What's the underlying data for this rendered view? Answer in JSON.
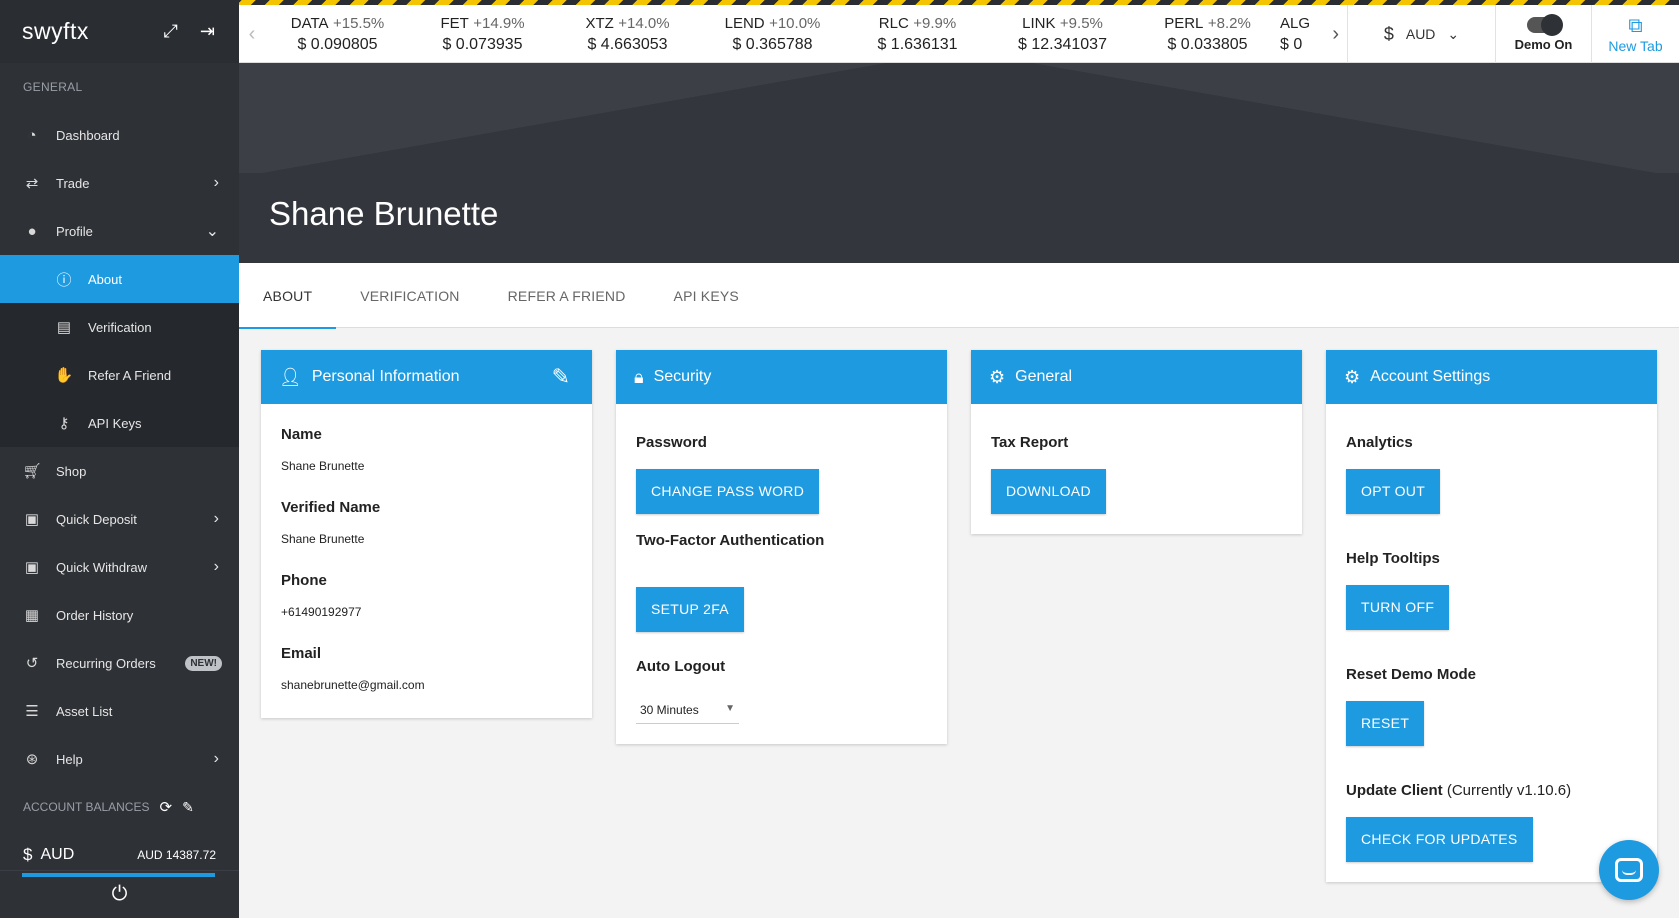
{
  "sidebar": {
    "brand": "swyftx",
    "section_general": "GENERAL",
    "items": [
      {
        "label": "Dashboard"
      },
      {
        "label": "Trade"
      },
      {
        "label": "Profile"
      },
      {
        "label": "About"
      },
      {
        "label": "Verification"
      },
      {
        "label": "Refer A Friend"
      },
      {
        "label": "API Keys"
      },
      {
        "label": "Shop"
      },
      {
        "label": "Quick Deposit"
      },
      {
        "label": "Quick Withdraw"
      },
      {
        "label": "Order History"
      },
      {
        "label": "Recurring Orders",
        "badge": "NEW!"
      },
      {
        "label": "Asset List"
      },
      {
        "label": "Help"
      }
    ],
    "balances_label": "ACCOUNT BALANCES",
    "balance_currency": "AUD",
    "balance_amount": "AUD 14387.72"
  },
  "ticker": [
    {
      "sym": "DATA",
      "chg": "+15.5%",
      "price": "0.090805"
    },
    {
      "sym": "FET",
      "chg": "+14.9%",
      "price": "0.073935"
    },
    {
      "sym": "XTZ",
      "chg": "+14.0%",
      "price": "4.663053"
    },
    {
      "sym": "LEND",
      "chg": "+10.0%",
      "price": "0.365788"
    },
    {
      "sym": "RLC",
      "chg": "+9.9%",
      "price": "1.636131"
    },
    {
      "sym": "LINK",
      "chg": "+9.5%",
      "price": "12.341037"
    },
    {
      "sym": "PERL",
      "chg": "+8.2%",
      "price": "0.033805"
    },
    {
      "sym": "ALG",
      "chg": "",
      "price": "0"
    }
  ],
  "topbar": {
    "currency": "AUD",
    "demo_label": "Demo On",
    "newtab_label": "New Tab"
  },
  "header": {
    "title": "Shane Brunette"
  },
  "tabs": [
    {
      "label": "ABOUT"
    },
    {
      "label": "VERIFICATION"
    },
    {
      "label": "REFER A FRIEND"
    },
    {
      "label": "API KEYS"
    }
  ],
  "personal": {
    "title": "Personal Information",
    "name_label": "Name",
    "name_value": "Shane Brunette",
    "verified_label": "Verified Name",
    "verified_value": "Shane Brunette",
    "phone_label": "Phone",
    "phone_value": "+61490192977",
    "email_label": "Email",
    "email_value": "shanebrunette@gmail.com"
  },
  "security": {
    "title": "Security",
    "password_label": "Password",
    "change_password_button": "CHANGE PASS WORD",
    "twofa_label": "Two-Factor Authentication",
    "setup_2fa_button": "SETUP 2FA",
    "logout_label": "Auto Logout",
    "logout_value": "30 Minutes"
  },
  "general": {
    "title": "General",
    "tax_label": "Tax Report",
    "download_button": "DOWNLOAD"
  },
  "account": {
    "title": "Account Settings",
    "analytics_label": "Analytics",
    "opt_out_button": "OPT OUT",
    "tooltips_label": "Help Tooltips",
    "turn_off_button": "TURN OFF",
    "reset_label": "Reset Demo Mode",
    "reset_button": "RESET",
    "update_label": "Update Client",
    "update_version": "(Currently v1.10.6)",
    "check_updates_button": "CHECK FOR UPDATES"
  },
  "colors": {
    "accent": "#1e9be0",
    "sidebar": "#2e3136",
    "banner": "#33363d"
  }
}
